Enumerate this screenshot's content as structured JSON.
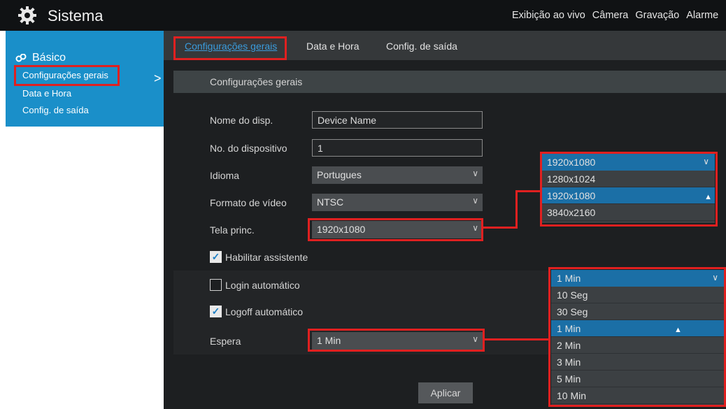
{
  "app": {
    "title": "Sistema",
    "icon": "gear-icon"
  },
  "topnav": [
    "Exibição ao vivo",
    "Câmera",
    "Gravação",
    "Alarme"
  ],
  "sidebar": {
    "section": "Básico",
    "section_icon": "link-icon",
    "items": [
      "Configurações gerais",
      "Data e Hora",
      "Config. de saída"
    ],
    "caret": ">"
  },
  "tabs": [
    "Configurações gerais",
    "Data e Hora",
    "Config. de saída"
  ],
  "section_title": "Configurações gerais",
  "form": {
    "device_name_label": "Nome do disp.",
    "device_name_value": "Device Name",
    "device_no_label": "No. do dispositivo",
    "device_no_value": "1",
    "language_label": "Idioma",
    "language_value": "Portugues",
    "video_format_label": "Formato de vídeo",
    "video_format_value": "NTSC",
    "main_screen_label": "Tela princ.",
    "main_screen_value": "1920x1080",
    "wizard_label": "Habilitar assistente",
    "wizard_checked": true,
    "autologin_label": "Login automático",
    "autologin_checked": false,
    "autologoff_label": "Logoff automático",
    "autologoff_checked": true,
    "wait_label": "Espera",
    "wait_value": "1 Min",
    "apply_label": "Aplicar"
  },
  "resolution_dropdown": {
    "current": "1920x1080",
    "options": [
      "1280x1024",
      "1920x1080",
      "3840x2160"
    ],
    "selected": "1920x1080"
  },
  "wait_dropdown": {
    "current": "1 Min",
    "options": [
      "10 Seg",
      "30 Seg",
      "1 Min",
      "2 Min",
      "3 Min",
      "5 Min",
      "10 Min"
    ],
    "selected": "1 Min"
  },
  "colors": {
    "accent": "#1a8fc9",
    "highlight": "#e02020",
    "selected": "#1b6fa6"
  }
}
